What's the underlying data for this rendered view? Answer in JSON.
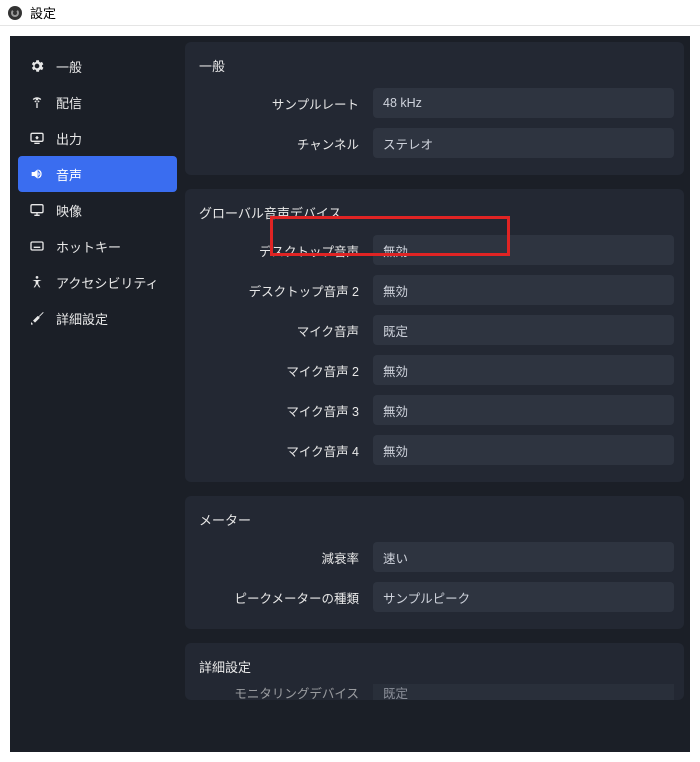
{
  "window": {
    "title": "設定"
  },
  "sidebar": {
    "items": [
      {
        "label": "一般"
      },
      {
        "label": "配信"
      },
      {
        "label": "出力"
      },
      {
        "label": "音声"
      },
      {
        "label": "映像"
      },
      {
        "label": "ホットキー"
      },
      {
        "label": "アクセシビリティ"
      },
      {
        "label": "詳細設定"
      }
    ]
  },
  "panels": {
    "general": {
      "title": "一般",
      "rows": [
        {
          "label": "サンプルレート",
          "value": "48 kHz"
        },
        {
          "label": "チャンネル",
          "value": "ステレオ"
        }
      ]
    },
    "global": {
      "title": "グローバル音声デバイス",
      "rows": [
        {
          "label": "デスクトップ音声",
          "value": "無効"
        },
        {
          "label": "デスクトップ音声 2",
          "value": "無効"
        },
        {
          "label": "マイク音声",
          "value": "既定"
        },
        {
          "label": "マイク音声 2",
          "value": "無効"
        },
        {
          "label": "マイク音声 3",
          "value": "無効"
        },
        {
          "label": "マイク音声 4",
          "value": "無効"
        }
      ]
    },
    "meter": {
      "title": "メーター",
      "rows": [
        {
          "label": "減衰率",
          "value": "速い"
        },
        {
          "label": "ピークメーターの種類",
          "value": "サンプルピーク"
        }
      ]
    },
    "advanced": {
      "title": "詳細設定",
      "rows": [
        {
          "label": "モニタリングデバイス",
          "value": "既定"
        }
      ]
    }
  }
}
